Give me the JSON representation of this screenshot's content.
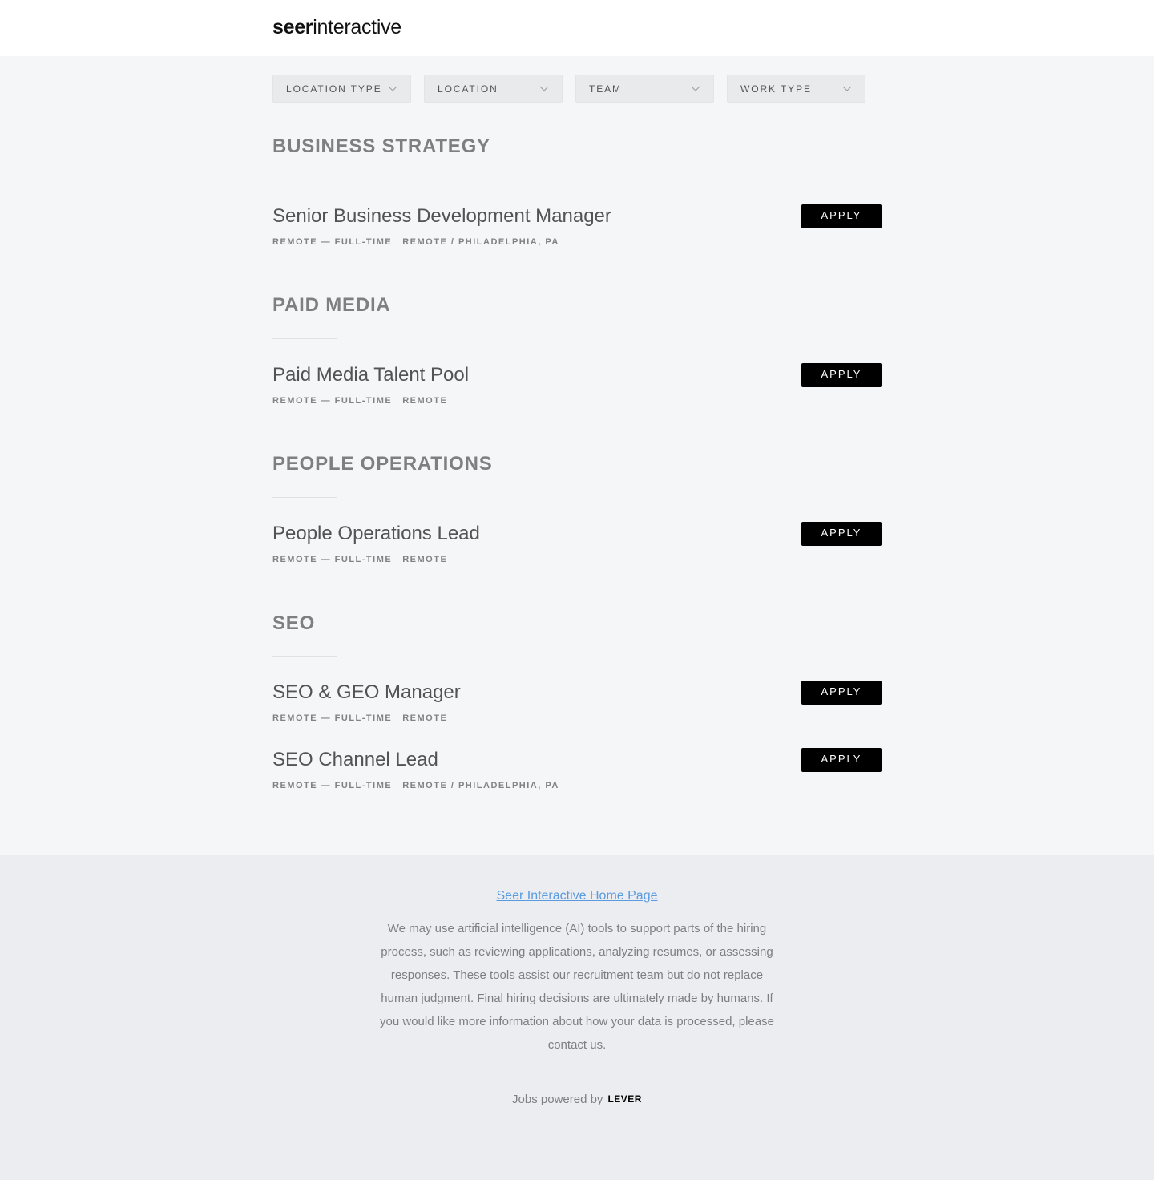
{
  "header": {
    "logo_bold": "seer",
    "logo_light": "interactive"
  },
  "filters": [
    {
      "label": "LOCATION TYPE"
    },
    {
      "label": "LOCATION"
    },
    {
      "label": "TEAM"
    },
    {
      "label": "WORK TYPE"
    }
  ],
  "sections": [
    {
      "title": "BUSINESS STRATEGY",
      "postings": [
        {
          "title": "Senior Business Development Manager",
          "commitment": "REMOTE — FULL-TIME",
          "location": "REMOTE / PHILADELPHIA, PA",
          "apply": "APPLY"
        }
      ]
    },
    {
      "title": "PAID MEDIA",
      "postings": [
        {
          "title": "Paid Media Talent Pool",
          "commitment": "REMOTE — FULL-TIME",
          "location": "REMOTE",
          "apply": "APPLY"
        }
      ]
    },
    {
      "title": "PEOPLE OPERATIONS",
      "postings": [
        {
          "title": "People Operations Lead",
          "commitment": "REMOTE — FULL-TIME",
          "location": "REMOTE",
          "apply": "APPLY"
        }
      ]
    },
    {
      "title": "SEO",
      "postings": [
        {
          "title": "SEO & GEO Manager",
          "commitment": "REMOTE — FULL-TIME",
          "location": "REMOTE",
          "apply": "APPLY"
        },
        {
          "title": "SEO Channel Lead",
          "commitment": "REMOTE — FULL-TIME",
          "location": "REMOTE / PHILADELPHIA, PA",
          "apply": "APPLY"
        }
      ]
    }
  ],
  "footer": {
    "home_link": "Seer Interactive Home Page",
    "notice": "We may use artificial intelligence (AI) tools to support parts of the hiring process, such as reviewing applications, analyzing resumes, or assessing responses. These tools assist our recruitment team but do not replace human judgment. Final hiring decisions are ultimately made by humans. If you would like more information about how your data is processed, please contact us.",
    "powered_by": "Jobs powered by",
    "lever": "LEVER"
  },
  "colors": {
    "apply_bg": "#000000",
    "link": "#5a9be0",
    "footer_bg": "#ecedf0",
    "page_bg": "#f5f6f7"
  }
}
